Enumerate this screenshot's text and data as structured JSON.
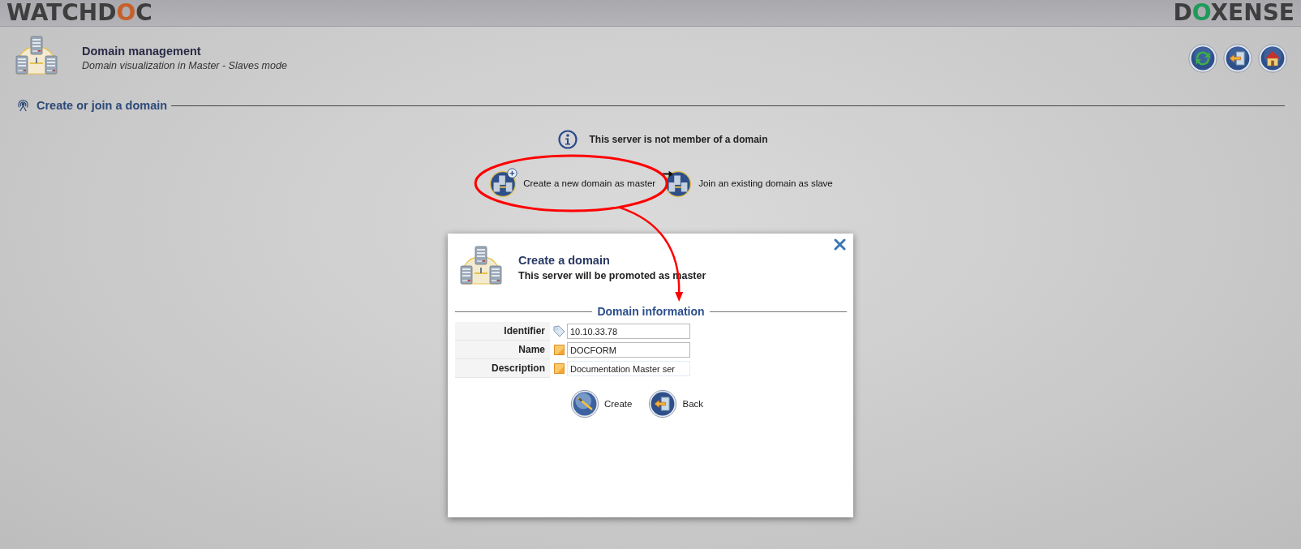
{
  "header": {
    "product_logo": "WATCHDOC",
    "company_logo": "DOXENSE"
  },
  "page": {
    "title": "Domain management",
    "subtitle": "Domain visualization in Master - Slaves mode"
  },
  "toolbar": [
    {
      "kind": "refresh"
    },
    {
      "kind": "back"
    },
    {
      "kind": "home"
    }
  ],
  "section": {
    "title": "Create or join a domain"
  },
  "info": "This server is not member of a domain",
  "options": [
    {
      "kind": "create",
      "label": "Create a new domain as master",
      "highlighted": true
    },
    {
      "kind": "join",
      "label": "Join an existing domain as slave",
      "highlighted": false
    }
  ],
  "dialog": {
    "title": "Create a domain",
    "subtitle": "This server will be promoted as master",
    "fieldset": "Domain information",
    "fields": [
      {
        "label": "Identifier",
        "kind": "tag",
        "value": "10.10.33.78"
      },
      {
        "label": "Name",
        "kind": "note",
        "value": "DOCFORM"
      },
      {
        "label": "Description",
        "kind": "note",
        "value": "Documentation Master ser"
      }
    ],
    "buttons": [
      {
        "kind": "create",
        "label": "Create"
      },
      {
        "kind": "back",
        "label": "Back"
      }
    ]
  }
}
